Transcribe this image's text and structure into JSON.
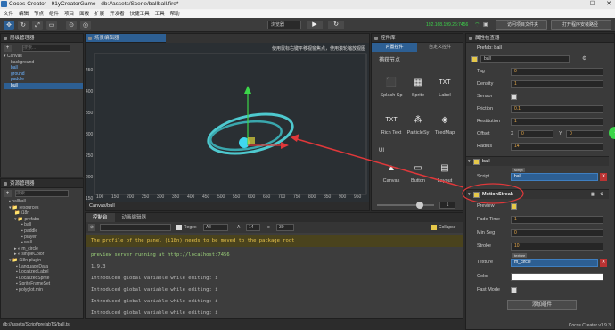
{
  "window": {
    "title": "Cocos Creator - 91yCreatorGame - db://assets/Scene/ballball.fire*",
    "controls": [
      "—",
      "☐",
      "✕"
    ]
  },
  "menu": [
    "文件",
    "编辑",
    "节点",
    "组件",
    "项目",
    "面板",
    "扩展",
    "开发者",
    "快捷工具",
    "工具",
    "帮助"
  ],
  "toolbar": {
    "preview_mode": "浏览器",
    "ip": "192.168.199.26:7456",
    "open_project_folder": "访问项目文件夹",
    "open_install_folder": "打开程序安装路径"
  },
  "hierarchy": {
    "title": "层级管理器",
    "search_placeholder": "搜索...",
    "items": [
      "Canvas",
      "background",
      "ball",
      "ground",
      "paddle",
      "bull"
    ]
  },
  "scene": {
    "title": "场景编辑器",
    "hint": "使用鼠标右键平移视窗焦点，使用滚轮缩放视图",
    "y_ticks": [
      "450",
      "400",
      "350",
      "300",
      "250",
      "200",
      "150"
    ],
    "x_ticks": [
      "100",
      "150",
      "200",
      "250",
      "300",
      "350",
      "400",
      "450",
      "500",
      "550",
      "600",
      "650",
      "700",
      "750",
      "800",
      "850",
      "900",
      "950"
    ],
    "breadcrumb": "Canvas/bull"
  },
  "widgets": {
    "title": "控件库",
    "tabs": [
      "内置控件",
      "自定义控件"
    ],
    "section_nodes": "捕获节点",
    "section_ui": "UI",
    "nodes": [
      {
        "label": "Splash Sp",
        "icon": "⬛"
      },
      {
        "label": "Sprite",
        "icon": "▦"
      },
      {
        "label": "Label",
        "icon": "TXT"
      },
      {
        "label": "Rich Text",
        "icon": "TXT"
      },
      {
        "label": "ParticleSy",
        "icon": "⁂"
      },
      {
        "label": "TiledMap",
        "icon": "◈"
      }
    ],
    "ui": [
      {
        "label": "Canvas",
        "icon": "▲"
      },
      {
        "label": "Button",
        "icon": "▭"
      },
      {
        "label": "Layout",
        "icon": "▤"
      }
    ],
    "zoom_value": "1"
  },
  "assets": {
    "title": "资源管理器",
    "search_placeholder": "搜索...",
    "items": [
      "ballball",
      "resources",
      "i18n",
      "prefabs",
      "ball",
      "paddle",
      "player",
      "wall",
      "m_circle",
      "singleColor",
      "i18n-plugin",
      "LanguageData",
      "LocalizedLabel",
      "LocalizedSprite",
      "SpriteFrameSet",
      "polyglot.min"
    ],
    "path": "db://assets/Script/prefabTS/ball.ts"
  },
  "console": {
    "tabs": [
      "控制台",
      "动画编辑器"
    ],
    "filter_label": "Regex",
    "level": "All",
    "font_size": "14",
    "lines_count": "30",
    "collapse_label": "Collapse",
    "lines": [
      "The profile of the panel (i18n) needs to be moved to the package root",
      "preview server running at http://localhost:7456",
      "1.9.3",
      "Introduced global variable while editing: i",
      "Introduced global variable while editing: i",
      "Introduced global variable while editing: i",
      "Introduced global variable while editing: i"
    ]
  },
  "inspector": {
    "title": "属性检查器",
    "prefab_label": "Prefab:",
    "prefab_name": "ball",
    "node_name": "ball",
    "props": [
      {
        "label": "Tag",
        "value": "0"
      },
      {
        "label": "Density",
        "value": "1"
      },
      {
        "label": "Sensor",
        "value": ""
      },
      {
        "label": "Friction",
        "value": "0.1"
      },
      {
        "label": "Restitution",
        "value": "1"
      },
      {
        "label": "Offset",
        "x": "0",
        "y": "0"
      },
      {
        "label": "Radius",
        "value": "14"
      }
    ],
    "script_section": "ball",
    "script_label": "Script",
    "script_tag": "script",
    "script_value": "ball",
    "motion_section": "MotionStreak",
    "motion_props": [
      {
        "label": "Preview",
        "value": ""
      },
      {
        "label": "Fade Time",
        "value": "1"
      },
      {
        "label": "Min Seg",
        "value": "0"
      },
      {
        "label": "Stroke",
        "value": "10"
      },
      {
        "label": "Texture",
        "tag": "texture",
        "value": "m_circle"
      },
      {
        "label": "Color",
        "value": ""
      },
      {
        "label": "Fast Mode",
        "value": ""
      }
    ],
    "add_component": "添加组件",
    "version": "Cocos Creator v1.9.3"
  },
  "colors": {
    "accent_blue": "#2d5f93",
    "annotation_red": "#e0383a",
    "streak_cyan": "#4ec9cf",
    "ip_green": "#3cd64a"
  }
}
